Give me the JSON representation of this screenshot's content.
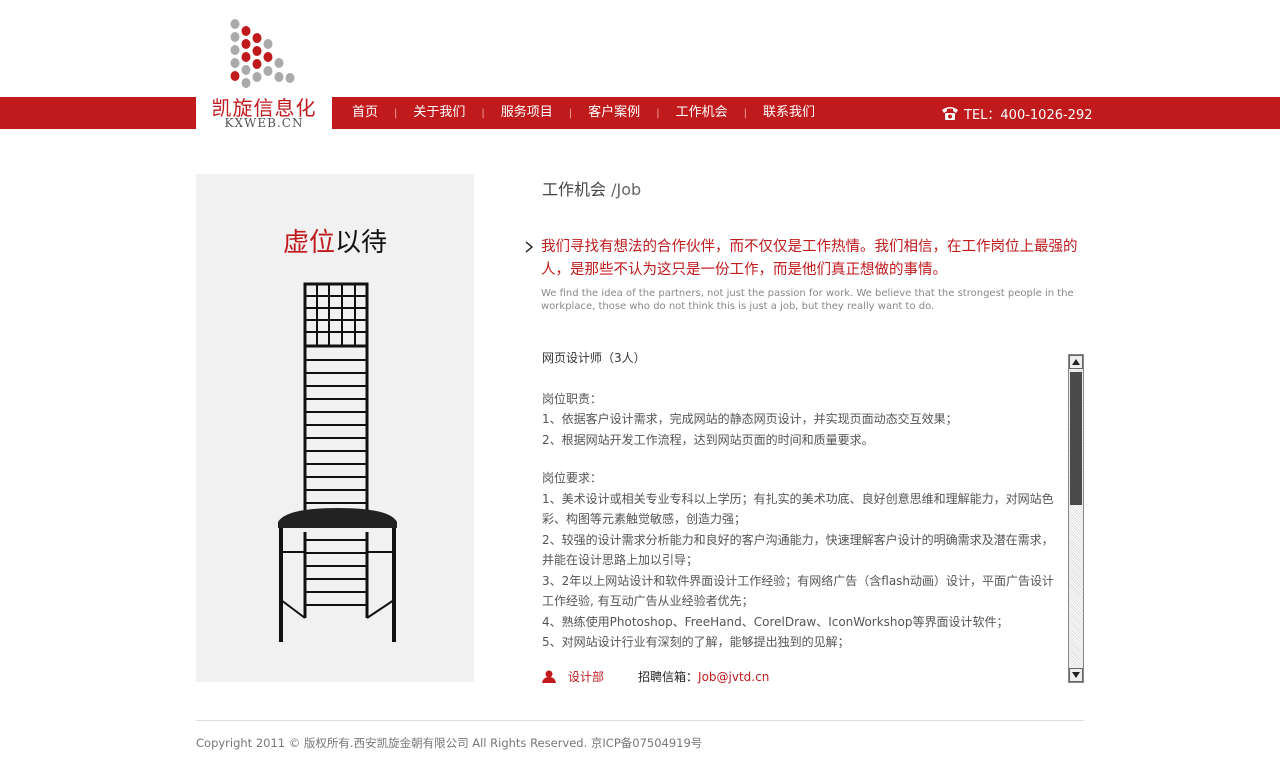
{
  "logo": {
    "cn": "凯旋信息化",
    "en": "KXWEB.CN"
  },
  "nav": {
    "items": [
      "首页",
      "关于我们",
      "服务项目",
      "客户案例",
      "工作机会",
      "联系我们"
    ],
    "separator": "|"
  },
  "tel": "TEL：400-1026-292",
  "panel": {
    "title_red": "虚位",
    "title_black": "以待"
  },
  "section": {
    "title_cn": "工作机会",
    "title_en": " /Job"
  },
  "lead": {
    "cn": "我们寻找有想法的合作伙伴，而不仅仅是工作热情。我们相信，在工作岗位上最强的人，是那些不认为这只是一份工作，而是他们真正想做的事情。",
    "en": "We find the idea of the partners, not just the passion for work. We believe that the strongest people in the workplace, those who do not think this is just a job, but they really want to do."
  },
  "job": {
    "title": "网页设计师（3人）",
    "duties_label": "岗位职责：",
    "duties": [
      "1、依据客户设计需求，完成网站的静态网页设计，并实现页面动态交互效果；",
      "2、根据网站开发工作流程，达到网站页面的时间和质量要求。"
    ],
    "requirements_label": "岗位要求：",
    "requirements": [
      "1、美术设计或相关专业专科以上学历；有扎实的美术功底、良好创意思维和理解能力，对网站色彩、构图等元素触觉敏感，创造力强；",
      "2、较强的设计需求分析能力和良好的客户沟通能力，快速理解客户设计的明确需求及潜在需求，并能在设计思路上加以引导；",
      "3、2年以上网站设计和软件界面设计工作经验；有网络广告（含flash动画）设计，平面广告设计工作经验, 有互动广告从业经验者优先；",
      "4、熟练使用Photoshop、FreeHand、CorelDraw、IconWorkshop等界面设计软件；",
      "5、对网站设计行业有深刻的了解，能够提出独到的见解；"
    ],
    "department": "设计部",
    "mail_label": "招聘信箱：",
    "mail_value": "Job@jvtd.cn",
    "scroll_fraction": 0.45
  },
  "footer": {
    "copyright": "Copyright 2011 © 版权所有.西安凯旋金朝有限公司 All Rights Reserved. 京ICP备07504919号"
  },
  "colors": {
    "brand_red": "#c01a1d",
    "text_gray": "#555555"
  }
}
